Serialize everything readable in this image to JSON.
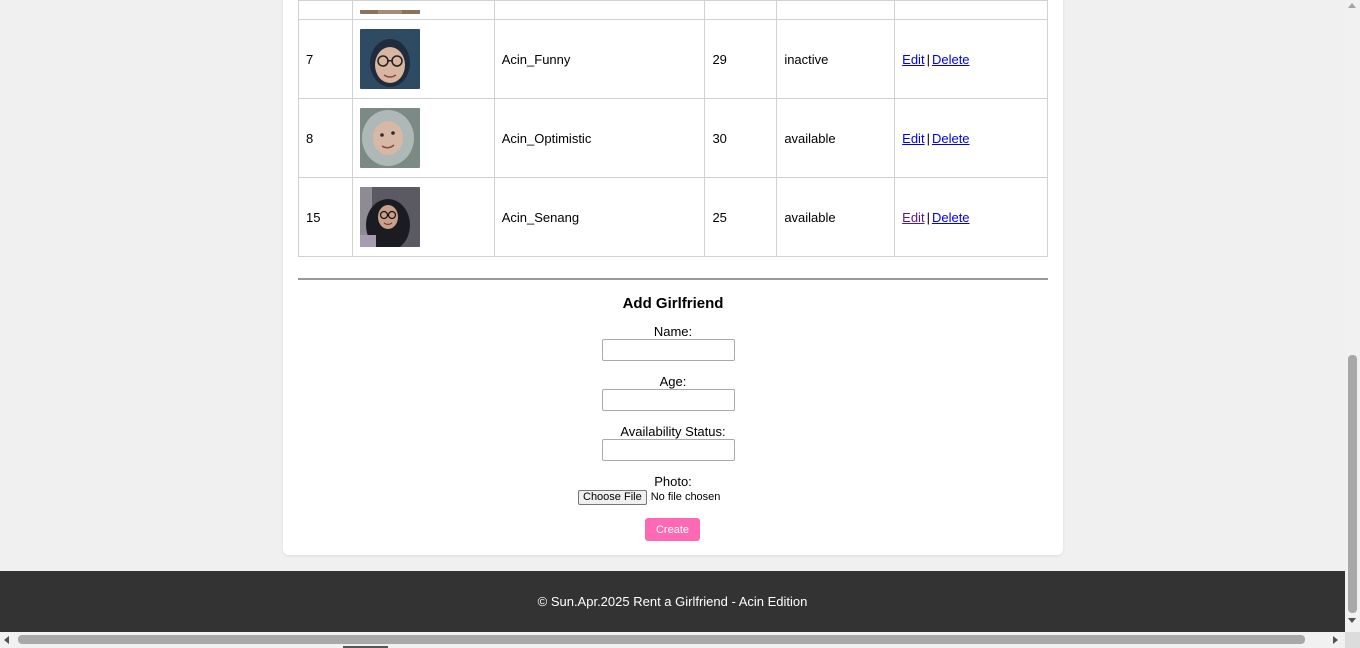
{
  "table": {
    "rows": [
      {
        "id": "",
        "name": "",
        "age": "",
        "status": "",
        "partial": true
      },
      {
        "id": "7",
        "name": "Acin_Funny",
        "age": "29",
        "status": "inactive",
        "edit_label": "Edit",
        "delete_label": "Delete"
      },
      {
        "id": "8",
        "name": "Acin_Optimistic",
        "age": "30",
        "status": "available",
        "edit_label": "Edit",
        "delete_label": "Delete"
      },
      {
        "id": "15",
        "name": "Acin_Senang",
        "age": "25",
        "status": "available",
        "edit_label": "Edit",
        "delete_label": "Delete"
      }
    ],
    "separator": "|"
  },
  "form": {
    "title": "Add Girlfriend",
    "name_label": "Name:",
    "name_value": "",
    "age_label": "Age:",
    "age_value": "",
    "status_label": "Availability Status:",
    "status_value": "",
    "photo_label": "Photo:",
    "choose_file_label": "Choose File",
    "no_file_text": "No file chosen",
    "create_label": "Create"
  },
  "footer": {
    "text": "© Sun.Apr.2025 Rent a Girlfriend - Acin Edition"
  },
  "colors": {
    "accent_pink": "#ff69b4",
    "footer_bg": "#333333",
    "link": "#0000ee",
    "visited_link": "#551a8b"
  }
}
